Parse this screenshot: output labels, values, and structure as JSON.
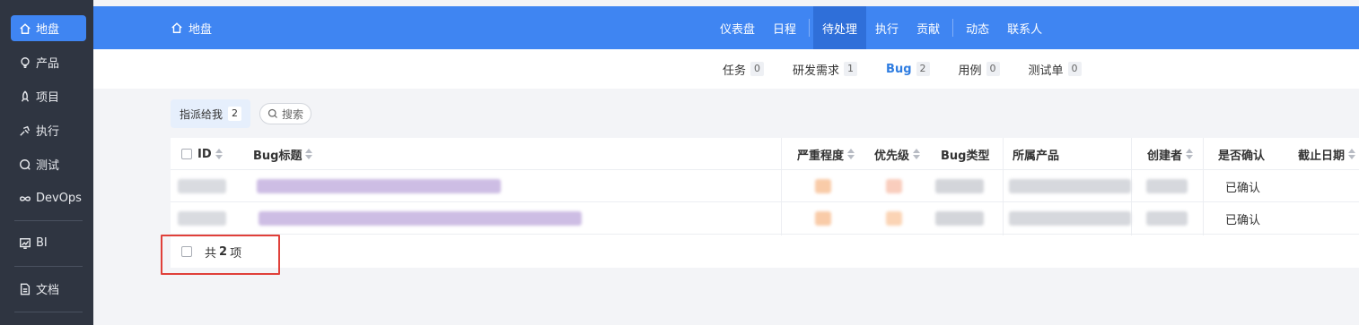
{
  "sidebar": {
    "items": [
      {
        "label": "地盘",
        "icon": "home-icon",
        "active": true
      },
      {
        "label": "产品",
        "icon": "bulb-icon"
      },
      {
        "label": "项目",
        "icon": "rocket-icon"
      },
      {
        "label": "执行",
        "icon": "run-icon"
      },
      {
        "label": "测试",
        "icon": "test-icon"
      },
      {
        "label": "DevOps",
        "icon": "infinity-icon"
      },
      {
        "label": "BI",
        "icon": "chart-icon"
      },
      {
        "label": "文档",
        "icon": "doc-icon"
      }
    ]
  },
  "header": {
    "breadcrumb": "地盘",
    "nav": [
      "仪表盘",
      "日程",
      "待处理",
      "执行",
      "贡献",
      "动态",
      "联系人"
    ],
    "active_nav": "待处理"
  },
  "subnav": {
    "tabs": [
      {
        "label": "任务",
        "count": "0"
      },
      {
        "label": "研发需求",
        "count": "1"
      },
      {
        "label": "Bug",
        "count": "2",
        "active": true
      },
      {
        "label": "用例",
        "count": "0"
      },
      {
        "label": "测试单",
        "count": "0"
      }
    ]
  },
  "filter": {
    "label": "指派给我",
    "count": "2",
    "search": "搜索"
  },
  "table": {
    "columns": [
      "ID",
      "Bug标题",
      "严重程度",
      "优先级",
      "Bug类型",
      "所属产品",
      "创建者",
      "是否确认",
      "截止日期"
    ],
    "rows": [
      {
        "confirmed": "已确认"
      },
      {
        "confirmed": "已确认"
      }
    ],
    "footer_prefix": "共",
    "footer_count": "2",
    "footer_suffix": "项"
  },
  "colors": {
    "accent": "#3f85f2",
    "sidebar": "#2f3541",
    "highlight": "#e0403a"
  }
}
